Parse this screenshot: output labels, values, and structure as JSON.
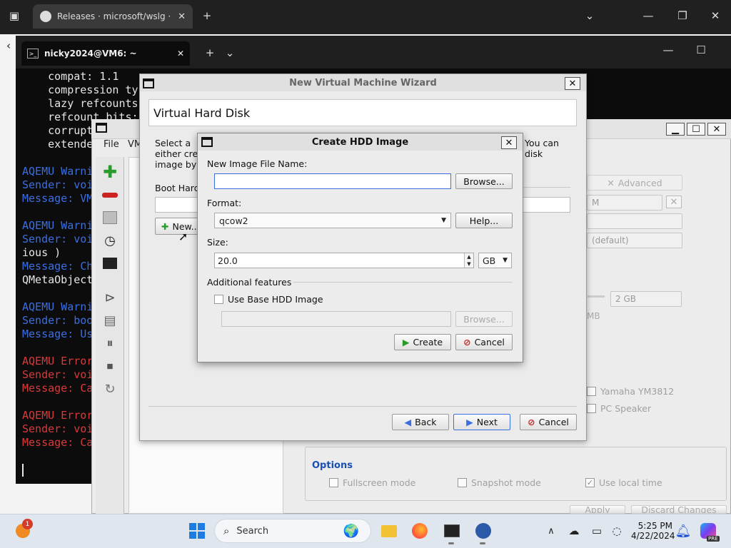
{
  "browser": {
    "tab_title": "Releases · microsoft/wslg · GitHub",
    "icons": [
      "tab-actions-icon",
      "github-icon",
      "close-icon",
      "new-tab-icon",
      "chevron-down-icon",
      "minimize-icon",
      "restore-icon",
      "close-window-icon"
    ]
  },
  "terminal": {
    "tab_title": "nicky2024@VM6: ~",
    "lines": [
      {
        "text": "    compat: 1.1",
        "color": "#e6e6e6"
      },
      {
        "text": "    compression ty",
        "color": "#e6e6e6"
      },
      {
        "text": "    lazy refcounts",
        "color": "#e6e6e6"
      },
      {
        "text": "    refcount bits:",
        "color": "#e6e6e6"
      },
      {
        "text": "    corrupt",
        "color": "#e6e6e6"
      },
      {
        "text": "    extende",
        "color": "#e6e6e6"
      },
      {
        "text": "",
        "color": "#e6e6e6"
      },
      {
        "text": "AQEMU Warni",
        "color": "#3b6fe0"
      },
      {
        "text": "Sender: voi",
        "color": "#3b6fe0"
      },
      {
        "text": "Message: VM",
        "color": "#3b6fe0"
      },
      {
        "text": "",
        "color": "#e6e6e6"
      },
      {
        "text": "AQEMU Warni",
        "color": "#3b6fe0"
      },
      {
        "text": "Sender: voi",
        "color": "#3b6fe0"
      },
      {
        "text": "ious )",
        "color": "#e6e6e6"
      },
      {
        "text": "Message: Ch",
        "color": "#3b6fe0"
      },
      {
        "text": "QMetaObject",
        "color": "#e6e6e6"
      },
      {
        "text": "",
        "color": "#e6e6e6"
      },
      {
        "text": "AQEMU Warni",
        "color": "#3b6fe0"
      },
      {
        "text": "Sender: boo",
        "color": "#3b6fe0"
      },
      {
        "text": "Message: Us",
        "color": "#3b6fe0"
      },
      {
        "text": "",
        "color": "#e6e6e6"
      },
      {
        "text": "AQEMU Error",
        "color": "#d83a3a"
      },
      {
        "text": "Sender: voi",
        "color": "#d83a3a"
      },
      {
        "text": "Message: Ca",
        "color": "#d83a3a"
      },
      {
        "text": "",
        "color": "#e6e6e6"
      },
      {
        "text": "AQEMU Error",
        "color": "#d83a3a"
      },
      {
        "text": "Sender: voi",
        "color": "#d83a3a"
      },
      {
        "text": "Message: Ca",
        "color": "#d83a3a"
      }
    ]
  },
  "qemu": {
    "menu": {
      "file": "File",
      "vm": "VM"
    },
    "advanced_button": "Advanced",
    "memory_value": "2 GB",
    "memory_unit": "MB",
    "machine_value": "(default)",
    "sound_yamaha": "Yamaha YM3812",
    "sound_pc_speaker": "PC Speaker",
    "options_title": "Options",
    "opt_fullscreen": "Fullscreen mode",
    "opt_snapshot": "Snapshot mode",
    "opt_localtime": "Use local time",
    "apply_button": "Apply",
    "discard_button": "Discard Changes"
  },
  "wizard": {
    "title": "New Virtual Machine Wizard",
    "heading": "Virtual Hard Disk",
    "desc_left_1": "Select a",
    "desc_left_2": "either cre",
    "desc_left_3": "image by",
    "desc_right_1": "You can",
    "desc_right_2": "disk",
    "boot_hdd_label": "Boot Hard",
    "new_button": "New...",
    "back_button": "Back",
    "next_button": "Next",
    "cancel_button": "Cancel"
  },
  "dialog": {
    "title": "Create HDD Image",
    "file_name_label": "New Image File Name:",
    "file_name_value": "",
    "browse_button": "Browse...",
    "format_label": "Format:",
    "format_value": "qcow2",
    "help_button": "Help...",
    "size_label": "Size:",
    "size_value": "20.0",
    "size_unit": "GB",
    "additional_features_label": "Additional features",
    "use_base_label": "Use Base HDD Image",
    "base_path_value": "",
    "browse2_button": "Browse...",
    "create_button": "Create",
    "cancel_button": "Cancel"
  },
  "taskbar": {
    "search_label": "Search",
    "notification_badge": "1",
    "time": "5:25 PM",
    "date": "4/22/2024",
    "copilot_badge": "PRE"
  },
  "colors": {
    "accent_blue": "#1a4fb3",
    "error_red": "#d83a3a",
    "warn_blue": "#3b6fe0"
  }
}
